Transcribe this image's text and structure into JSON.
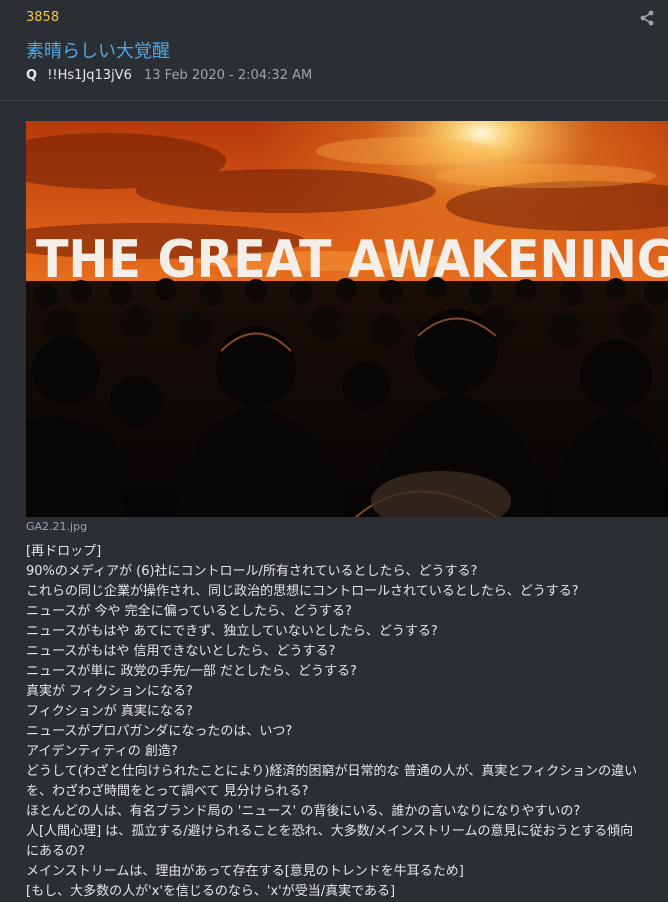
{
  "post": {
    "number": "3858",
    "title": "素晴らしい大覚醒",
    "author": "Q",
    "tripcode": "!!Hs1Jq13jV6",
    "timestamp": "13 Feb 2020 - 2:04:32 AM",
    "image_text": "THE GREAT AWAKENING",
    "image_filename": "GA2.21.jpg",
    "body_lines": [
      "[再ドロップ]",
      "90%のメディアが (6)社にコントロール/所有されているとしたら、どうする?",
      "これらの同じ企業が操作され、同じ政治的思想にコントロールされているとしたら、どうする?",
      "ニュースが 今や 完全に偏っているとしたら、どうする?",
      "ニュースがもはや あてにできず、独立していないとしたら、どうする?",
      "ニュースがもはや 信用できないとしたら、どうする?",
      "ニュースが単に 政党の手先/一部 だとしたら、どうする?",
      "真実が フィクションになる?",
      "フィクションが 真実になる?",
      "ニュースがプロパガンダになったのは、いつ?",
      "アイデンティティの 創造?",
      "どうして(わざと仕向けられたことにより)経済的困窮が日常的な 普通の人が、真実とフィクションの違い",
      "を、わざわざ時間をとって調べて 見分けられる?",
      "ほとんどの人は、有名ブランド局の 'ニュース' の背後にいる、誰かの言いなりになりやすいの?",
      "人[人間心理] は、孤立する/避けられることを恐れ、大多数/メインストリームの意見に従おうとする傾向",
      "にあるの?",
      "メインストリームは、理由があって存在する[意見のトレンドを牛耳るため]",
      "[もし、大多数の人が'x'を信じるのなら、'x'が受当/真実である]"
    ]
  },
  "icons": {
    "share": "share-icon"
  },
  "colors": {
    "number": "#f2c744",
    "title": "#4fa7e6",
    "background": "#2b2e33"
  }
}
